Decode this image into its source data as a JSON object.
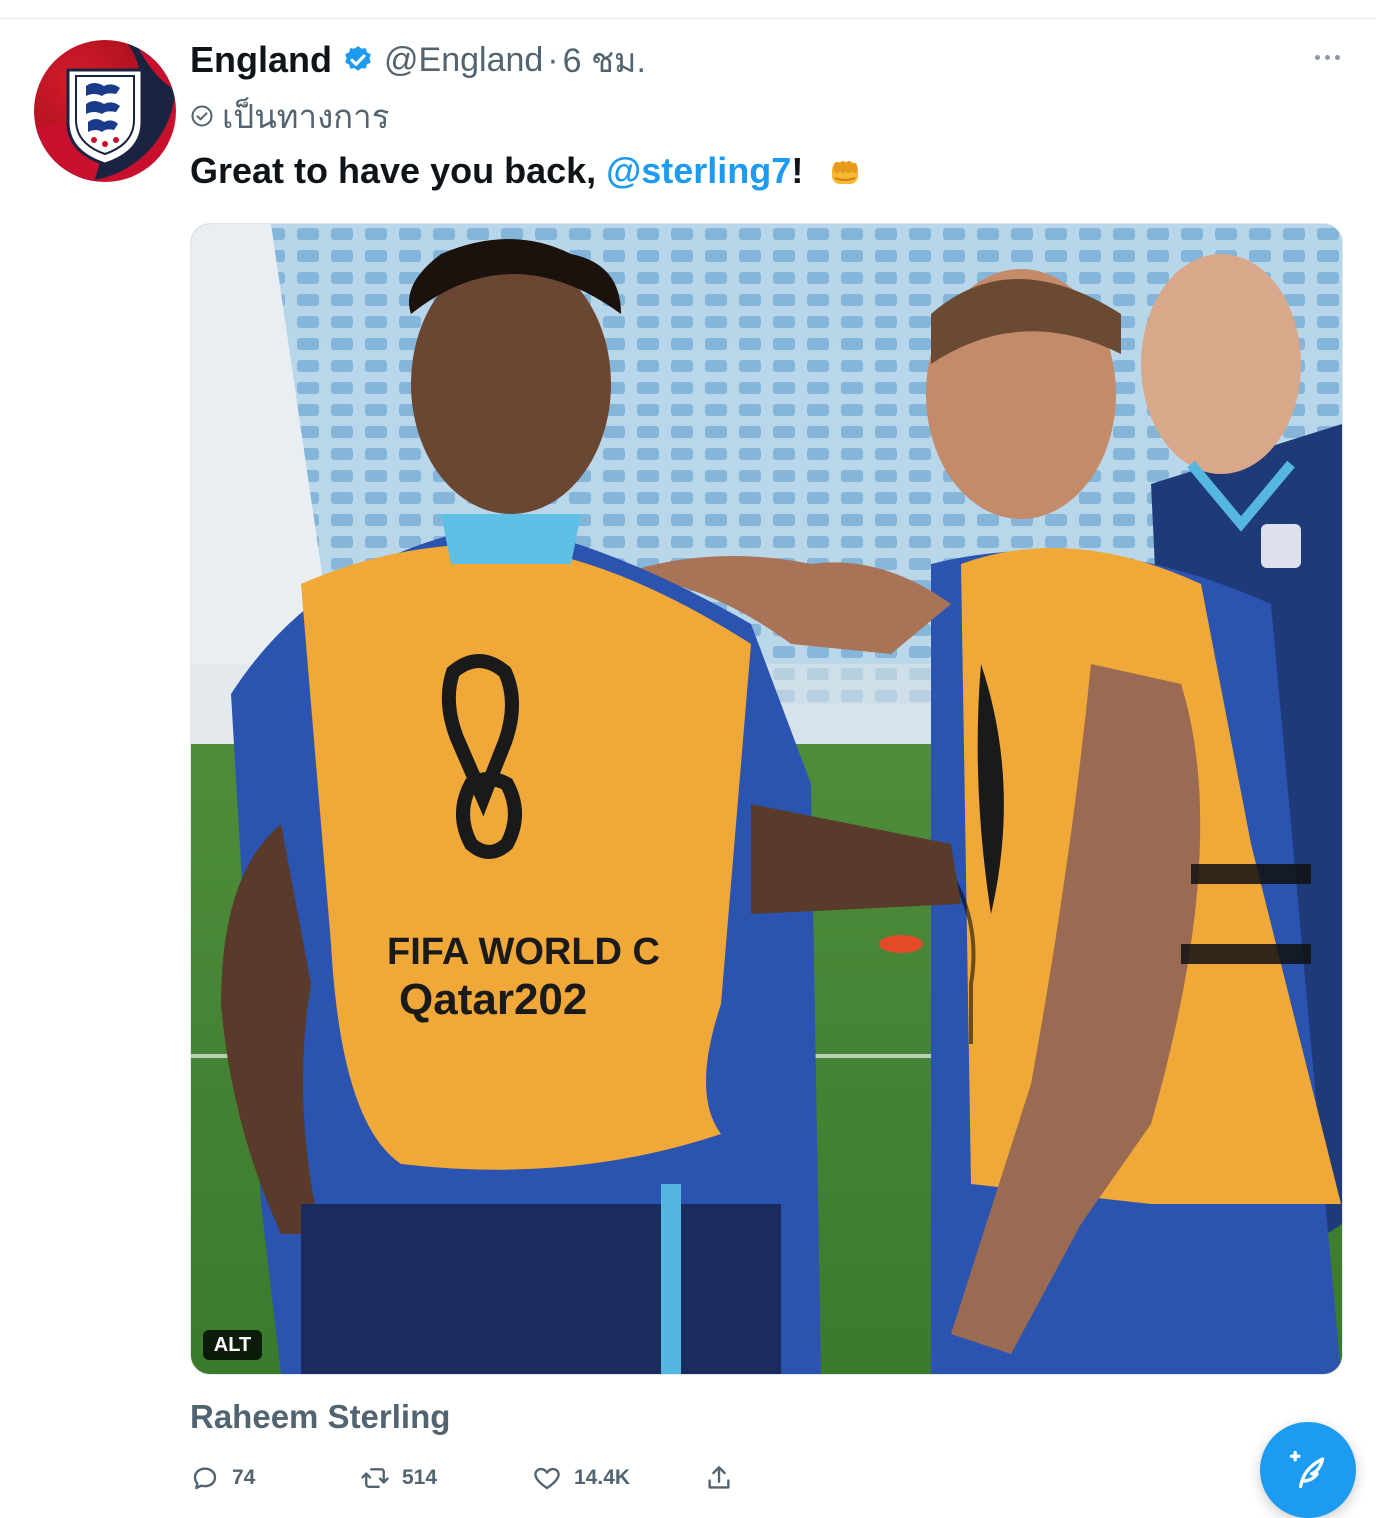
{
  "tweet": {
    "display_name": "England",
    "handle": "@England",
    "separator": "·",
    "time": "6 ชม.",
    "official_label": "เป็นทางการ",
    "text_before": "Great to have you back, ",
    "mention": "@sterling7",
    "text_after": "!",
    "emoji_icon": "oncoming-fist-emoji"
  },
  "media": {
    "alt_badge": "ALT",
    "bib_text_line1": "FIFA WORLD C",
    "bib_text_line2": "Qatar202"
  },
  "tagged_person": "Raheem Sterling",
  "actions": {
    "reply_count": "74",
    "retweet_count": "514",
    "like_count": "14.4K"
  },
  "colors": {
    "accent": "#1d9bf0",
    "text_primary": "#0f1419",
    "text_secondary": "#536471"
  }
}
